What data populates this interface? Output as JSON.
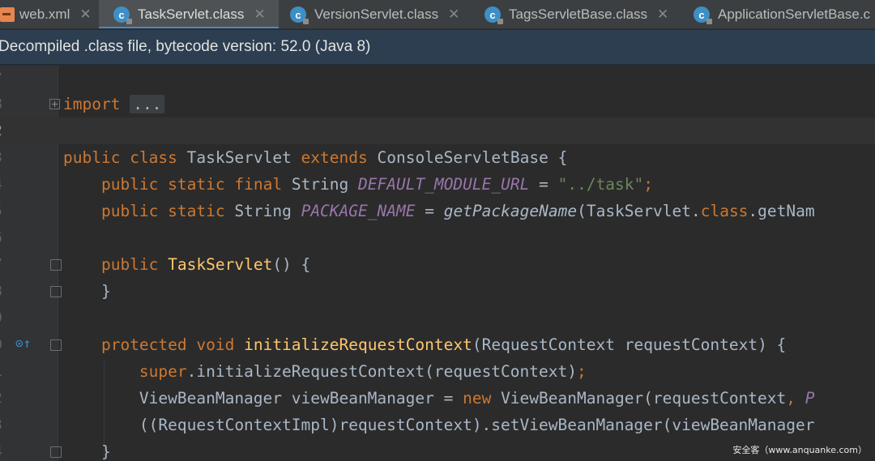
{
  "tabs": [
    {
      "label": "web.xml",
      "icon": "xml-file-icon",
      "active": false
    },
    {
      "label": "TaskServlet.class",
      "icon": "class-file-icon",
      "active": true
    },
    {
      "label": "VersionServlet.class",
      "icon": "class-file-icon",
      "active": false
    },
    {
      "label": "TagsServletBase.class",
      "icon": "class-file-icon",
      "active": false
    },
    {
      "label": "ApplicationServletBase.c",
      "icon": "class-file-icon",
      "active": false
    }
  ],
  "banner": {
    "text": "Decompiled .class file, bytecode version: 52.0 (Java 8)"
  },
  "editor": {
    "line_numbers": [
      "7",
      "8",
      "2",
      "3",
      "4",
      "5",
      "6",
      "7",
      "8",
      "9",
      "0",
      "1",
      "2",
      "3",
      "4"
    ],
    "lines": {
      "l2_import_kw": "import",
      "l2_ellipsis": "...",
      "l4_public": "public",
      "l4_class": "class",
      "l4_name": "TaskServlet",
      "l4_extends": "extends",
      "l4_base": "ConsoleServletBase",
      "l4_brace": "{",
      "l5_public": "public",
      "l5_static": "static",
      "l5_final": "final",
      "l5_type": "String",
      "l5_const": "DEFAULT_MODULE_URL",
      "l5_eq": "=",
      "l5_str": "\"../task\"",
      "l5_semi": ";",
      "l6_public": "public",
      "l6_static": "static",
      "l6_type": "String",
      "l6_const": "PACKAGE_NAME",
      "l6_eq": "=",
      "l6_call": "getPackageName",
      "l6_args": "(TaskServlet.",
      "l6_class": "class",
      "l6_rest": ".getNam",
      "l8_public": "public",
      "l8_ctor": "TaskServlet",
      "l8_rest": "() {",
      "l9_close": "}",
      "l11_protected": "protected",
      "l11_void": "void",
      "l11_method": "initializeRequestContext",
      "l11_params": "(RequestContext requestContext) {",
      "l12_super": "super",
      "l12_rest": ".initializeRequestContext(requestContext)",
      "l12_semi": ";",
      "l13_decl": "ViewBeanManager viewBeanManager = ",
      "l13_new": "new",
      "l13_rest": " ViewBeanManager(requestContext",
      "l13_comma": ",",
      "l13_trunc": " P",
      "l14_text": "((RequestContextImpl)requestContext).setViewBeanManager(viewBeanManager",
      "l15_close": "}"
    }
  },
  "watermark": "安全客（www.anquanke.com）",
  "colors": {
    "keyword": "#cc7832",
    "function": "#ffc66d",
    "constant": "#9876aa",
    "string": "#6a8759",
    "text": "#a9b7c6",
    "banner_bg": "#2c3e50"
  }
}
